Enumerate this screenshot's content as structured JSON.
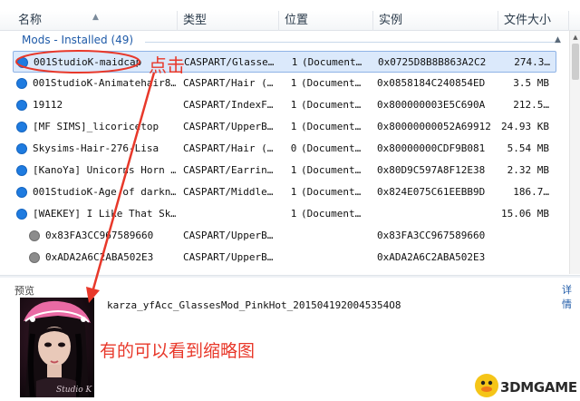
{
  "columns": {
    "name": "名称",
    "type": "类型",
    "location": "位置",
    "instance": "实例",
    "size": "文件大小"
  },
  "group": {
    "title": "Mods - Installed",
    "count": "(49)"
  },
  "rows": [
    {
      "name": "001StudioK-maidcap",
      "type": "CASPART/Glasse…",
      "n": "1",
      "loc": "(Document…",
      "inst": "0x0725D8B8B863A2C2",
      "size": "274.3…",
      "dot": "blue",
      "selected": true
    },
    {
      "name": "001StudioK-Animatehair8…",
      "type": "CASPART/Hair (…",
      "n": "1",
      "loc": "(Document…",
      "inst": "0x0858184C240854ED",
      "size": "3.5 MB",
      "dot": "blue"
    },
    {
      "name": "19112",
      "type": "CASPART/IndexF…",
      "n": "1",
      "loc": "(Document…",
      "inst": "0x800000003E5C690A",
      "size": "212.5…",
      "dot": "blue"
    },
    {
      "name": "[MF SIMS]_licoricetop",
      "type": "CASPART/UpperB…",
      "n": "1",
      "loc": "(Document…",
      "inst": "0x80000000052A69912",
      "size": "24.93 KB",
      "dot": "blue"
    },
    {
      "name": "Skysims-Hair-276-Lisa",
      "type": "CASPART/Hair (…",
      "n": "0",
      "loc": "(Document…",
      "inst": "0x80000000CDF9B081",
      "size": "5.54 MB",
      "dot": "blue"
    },
    {
      "name": "[KanoYa] Unicorns Horn …",
      "type": "CASPART/Earrin…",
      "n": "1",
      "loc": "(Document…",
      "inst": "0x80D9C597A8F12E38",
      "size": "2.32 MB",
      "dot": "blue"
    },
    {
      "name": "001StudioK-Age of darkn…",
      "type": "CASPART/Middle…",
      "n": "1",
      "loc": "(Document…",
      "inst": "0x824E075C61EEBB9D",
      "size": "186.7…",
      "dot": "blue"
    },
    {
      "name": "[WAEKEY] I Like That Sk…",
      "type": "",
      "n": "1",
      "loc": "(Document…",
      "inst": "",
      "size": "15.06 MB",
      "dot": "blue"
    },
    {
      "name": "0x83FA3CC967589660",
      "type": "CASPART/UpperB…",
      "n": "",
      "loc": "",
      "inst": "0x83FA3CC967589660",
      "size": "",
      "dot": "gray",
      "indent": true
    },
    {
      "name": "0xADA2A6C2ABA502E3",
      "type": "CASPART/UpperB…",
      "n": "",
      "loc": "",
      "inst": "0xADA2A6C2ABA502E3",
      "size": "",
      "dot": "gray",
      "indent": true
    }
  ],
  "preview": {
    "label": "预览",
    "detail_link": "详情",
    "filename": "karza_yfAcc_GlassesMod_PinkHot_2015041920045354O8"
  },
  "annotations": {
    "click": "点击",
    "thumbnail": "有的可以看到缩略图"
  },
  "watermark": {
    "text": "3DMGAME"
  },
  "colors": {
    "accent": "#1e5aa8",
    "annotation": "#e8382a",
    "selected_row": "#dbe9fb"
  }
}
